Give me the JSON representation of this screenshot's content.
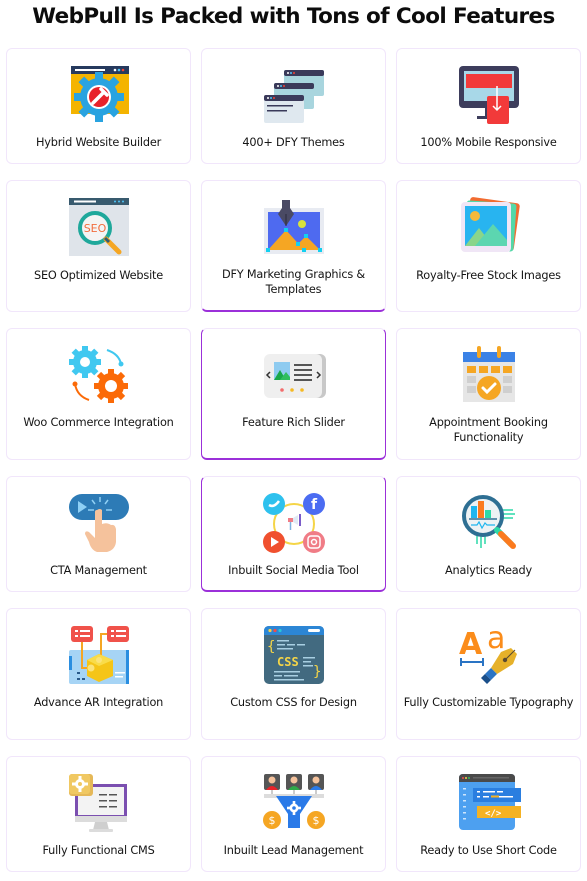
{
  "page": {
    "title": "WebPull Is Packed with Tons of Cool Features"
  },
  "features": [
    {
      "label": "Hybrid Website Builder",
      "icon": "website-builder-gear-wrench-icon"
    },
    {
      "label": "400+ DFY Themes",
      "icon": "stacked-browser-windows-icon"
    },
    {
      "label": "100% Mobile Responsive",
      "icon": "monitor-mobile-icon"
    },
    {
      "label": "SEO Optimized Website",
      "icon": "seo-magnifier-icon"
    },
    {
      "label": "DFY Marketing Graphics & Templates",
      "icon": "pen-tool-graphic-icon"
    },
    {
      "label": "Royalty-Free Stock Images",
      "icon": "stock-images-icon"
    },
    {
      "label": "Woo Commerce Integration",
      "icon": "gears-integration-icon"
    },
    {
      "label": "Feature Rich Slider",
      "icon": "slider-icon"
    },
    {
      "label": "Appointment Booking Functionality",
      "icon": "calendar-check-icon"
    },
    {
      "label": "CTA Management",
      "icon": "click-button-hand-icon"
    },
    {
      "label": "Inbuilt Social Media Tool",
      "icon": "social-media-icon"
    },
    {
      "label": "Analytics Ready",
      "icon": "analytics-magnifier-icon"
    },
    {
      "label": "Advance AR Integration",
      "icon": "ar-cube-icon"
    },
    {
      "label": "Custom CSS for Design",
      "icon": "css-code-window-icon"
    },
    {
      "label": "Fully Customizable Typography",
      "icon": "typography-pen-icon"
    },
    {
      "label": "Fully Functional CMS",
      "icon": "cms-monitor-gear-icon"
    },
    {
      "label": "Inbuilt Lead Management",
      "icon": "lead-funnel-icon"
    },
    {
      "label": "Ready to Use Short Code",
      "icon": "shortcode-window-icon"
    }
  ],
  "colors": {
    "accent_border": "#9b30d9",
    "card_border": "#f1e6fb"
  }
}
